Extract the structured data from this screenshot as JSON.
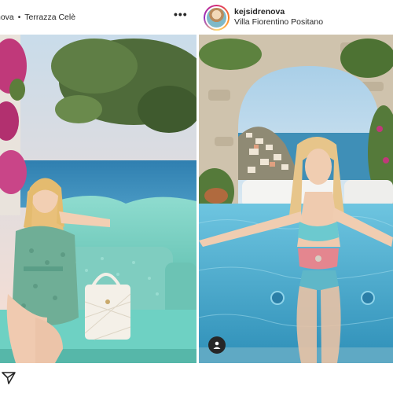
{
  "left_post": {
    "username_fragment": "nova",
    "separator": "•",
    "location": "Terrazza Celè",
    "more_icon": "more-horizontal-icon"
  },
  "right_post": {
    "username": "kejsidrenova",
    "location": "Villa Fiorentino Positano",
    "avatar": "profile-avatar",
    "tag_icon": "user-tag-icon"
  },
  "footer": {
    "share_icon": "send-icon"
  },
  "colors": {
    "turquoise": "#7fd3c6",
    "sea": "#3f8fb7",
    "pool": "#4fb6d8",
    "bougainvillea": "#c0397a"
  }
}
